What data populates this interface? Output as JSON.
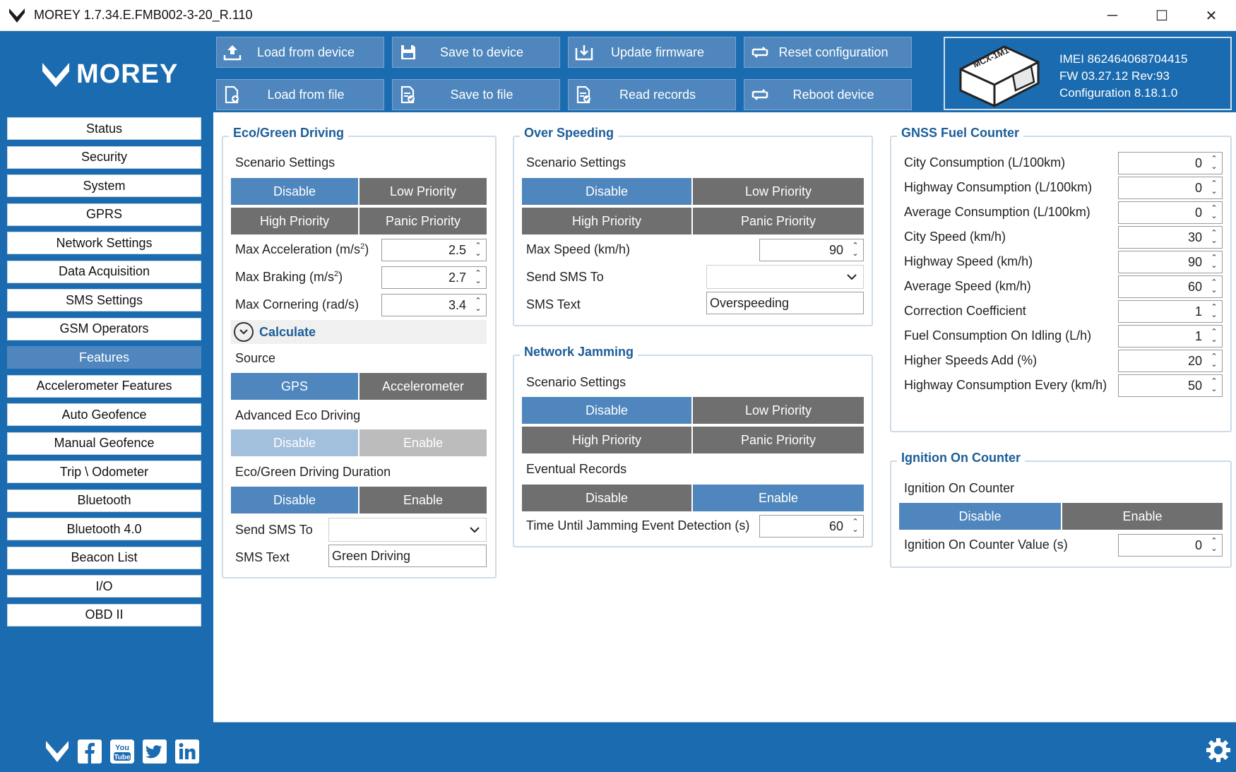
{
  "window": {
    "title": "MOREY 1.7.34.E.FMB002-3-20_R.110",
    "minimize": "─",
    "maximize": "☐",
    "close": "✕"
  },
  "brand": {
    "logo_text": "MOREY"
  },
  "sidebar": {
    "items": [
      {
        "label": "Status"
      },
      {
        "label": "Security"
      },
      {
        "label": "System"
      },
      {
        "label": "GPRS"
      },
      {
        "label": "Network Settings"
      },
      {
        "label": "Data Acquisition"
      },
      {
        "label": "SMS Settings"
      },
      {
        "label": "GSM Operators"
      },
      {
        "label": "Features",
        "active": true
      },
      {
        "label": "Accelerometer Features"
      },
      {
        "label": "Auto Geofence"
      },
      {
        "label": "Manual Geofence"
      },
      {
        "label": "Trip \\ Odometer"
      },
      {
        "label": "Bluetooth"
      },
      {
        "label": "Bluetooth 4.0"
      },
      {
        "label": "Beacon List"
      },
      {
        "label": "I/O"
      },
      {
        "label": "OBD II"
      }
    ]
  },
  "toolbar": {
    "load_device": "Load from device",
    "save_device": "Save to device",
    "update_fw": "Update firmware",
    "reset_cfg": "Reset configuration",
    "load_file": "Load from file",
    "save_file": "Save to file",
    "read_records": "Read records",
    "reboot": "Reboot device"
  },
  "device": {
    "imei": "IMEI  862464068704415",
    "fw": "FW  03.27.12 Rev:93",
    "config": "Configuration  8.18.1.0",
    "model_label": "MCX-1M1"
  },
  "eco": {
    "title": "Eco/Green Driving",
    "scenario_label": "Scenario Settings",
    "disable": "Disable",
    "low": "Low Priority",
    "high": "High Priority",
    "panic": "Panic Priority",
    "max_acc_label": "Max Acceleration   (m/s",
    "max_acc": "2.5",
    "max_brake_label": "Max Braking   (m/s",
    "max_brake": "2.7",
    "max_corner_label": "Max Cornering   (rad/s)",
    "max_corner": "3.4",
    "sq": "2",
    "paren": ")",
    "calculate": "Calculate",
    "source_label": "Source",
    "gps": "GPS",
    "accelerometer": "Accelerometer",
    "adv_label": "Advanced Eco Driving",
    "adv_disable": "Disable",
    "adv_enable": "Enable",
    "duration_label": "Eco/Green Driving Duration",
    "dur_disable": "Disable",
    "dur_enable": "Enable",
    "send_sms_label": "Send SMS To",
    "sms_text_label": "SMS Text",
    "sms_text": "Green Driving"
  },
  "overspeed": {
    "title": "Over Speeding",
    "scenario_label": "Scenario Settings",
    "disable": "Disable",
    "low": "Low Priority",
    "high": "High Priority",
    "panic": "Panic Priority",
    "max_speed_label": "Max Speed   (km/h)",
    "max_speed": "90",
    "send_sms_label": "Send SMS To",
    "sms_text_label": "SMS Text",
    "sms_text": "Overspeeding"
  },
  "jamming": {
    "title": "Network Jamming",
    "scenario_label": "Scenario Settings",
    "disable": "Disable",
    "low": "Low Priority",
    "high": "High Priority",
    "panic": "Panic Priority",
    "eventual_label": "Eventual Records",
    "ev_disable": "Disable",
    "ev_enable": "Enable",
    "time_label": "Time Until Jamming Event Detection   (s)",
    "time": "60"
  },
  "gnss": {
    "title": "GNSS Fuel Counter",
    "rows": [
      {
        "label": "City Consumption   (L/100km)",
        "value": "0"
      },
      {
        "label": "Highway Consumption   (L/100km)",
        "value": "0"
      },
      {
        "label": "Average Consumption   (L/100km)",
        "value": "0"
      },
      {
        "label": "City Speed   (km/h)",
        "value": "30"
      },
      {
        "label": "Highway Speed   (km/h)",
        "value": "90"
      },
      {
        "label": "Average Speed   (km/h)",
        "value": "60"
      },
      {
        "label": "Correction Coefficient",
        "value": "1"
      },
      {
        "label": "Fuel Consumption On Idling   (L/h)",
        "value": "1"
      },
      {
        "label": "Higher Speeds Add   (%)",
        "value": "20"
      },
      {
        "label": "Highway Consumption Every   (km/h)",
        "value": "50"
      }
    ]
  },
  "ignition": {
    "title": "Ignition On Counter",
    "sub_label": "Ignition On Counter",
    "disable": "Disable",
    "enable": "Enable",
    "value_label": "Ignition On Counter Value   (s)",
    "value": "0"
  },
  "colors": {
    "brand_blue": "#1b6bb0",
    "selected_blue": "#4e86bd",
    "unselected_gray": "#6f6f6f",
    "title_blue": "#1b5d99"
  }
}
